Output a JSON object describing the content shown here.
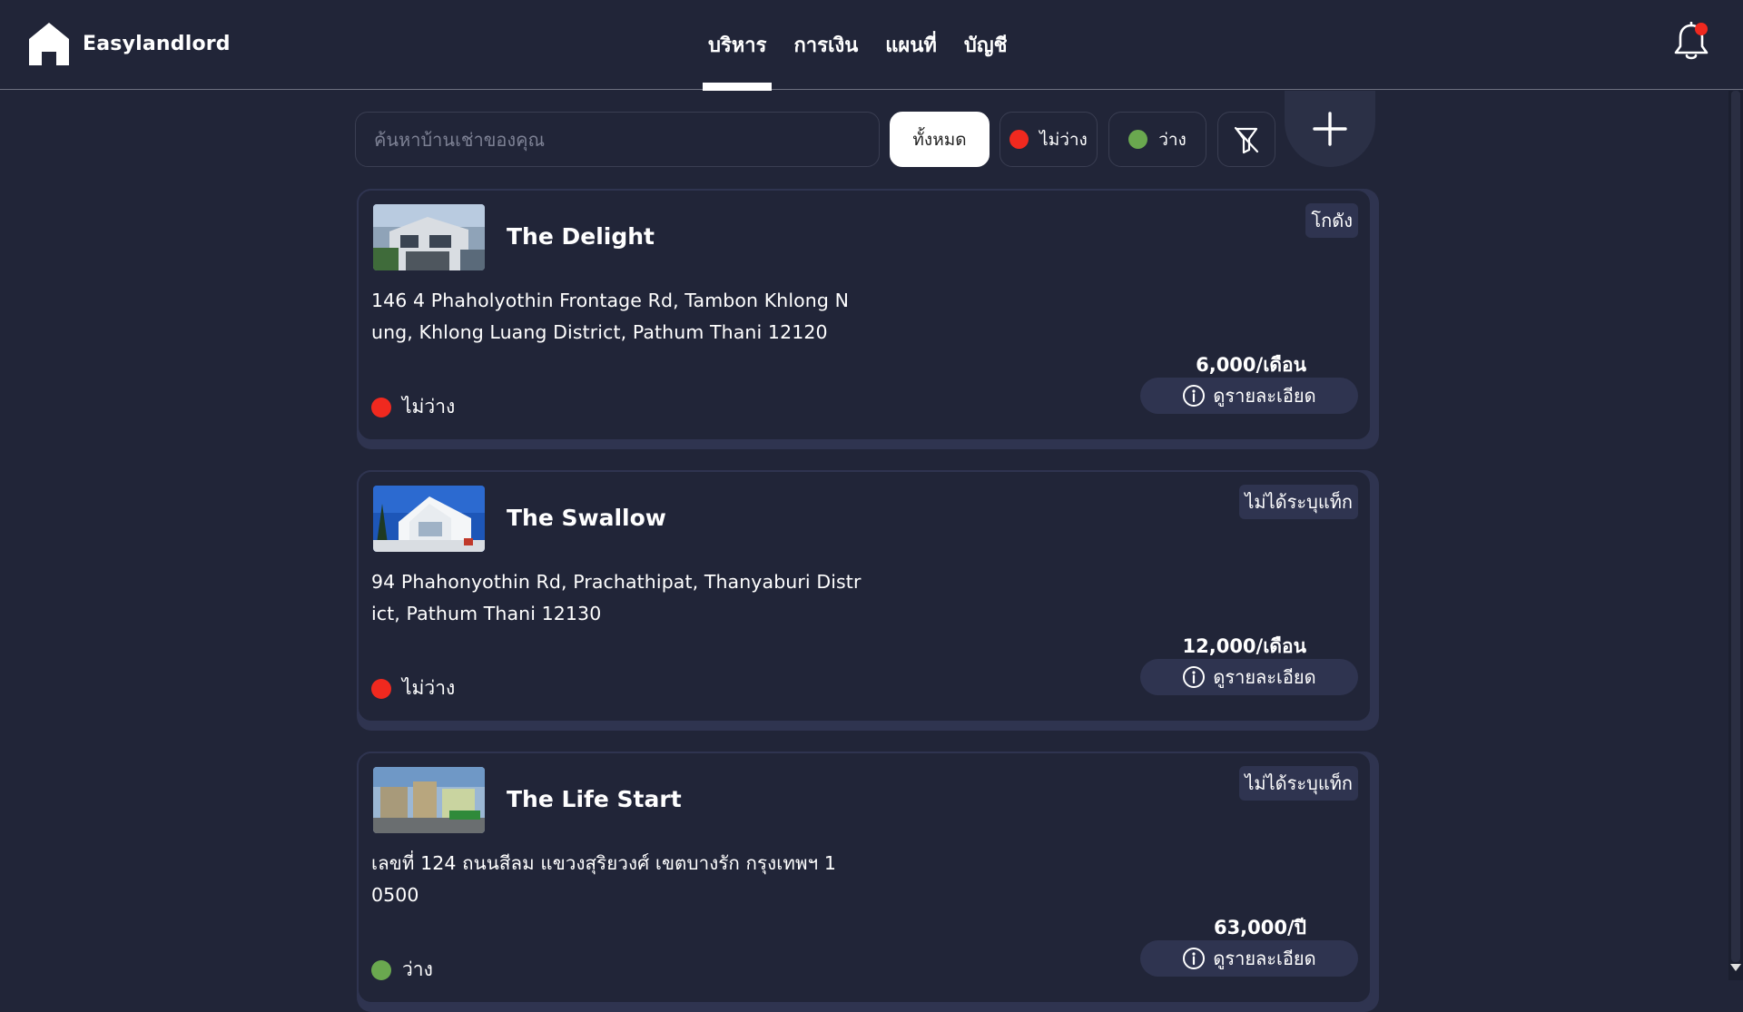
{
  "app": {
    "brand_name": "Easylandlord"
  },
  "nav": {
    "items": [
      {
        "label": "บริหาร",
        "active": true
      },
      {
        "label": "การเงิน",
        "active": false
      },
      {
        "label": "แผนที่",
        "active": false
      },
      {
        "label": "บัญชี",
        "active": false
      }
    ]
  },
  "notifications": {
    "icon": "bell-icon",
    "has_unread": true,
    "dot_color": "#f0291f"
  },
  "filters": {
    "search_placeholder": "ค้นหาบ้านเช่าของคุณ",
    "search_value": "",
    "all_label": "ทั้งหมด",
    "occupied_label": "ไม่ว่าง",
    "vacant_label": "ว่าง",
    "selected": "all",
    "clear_filter_icon": "filter-off-icon",
    "add_icon": "plus-icon"
  },
  "colors": {
    "background": "#212538",
    "card_border": "#2f3450",
    "occupied": "#f0291f",
    "vacant": "#6aa84f"
  },
  "properties": [
    {
      "name": "The Delight",
      "tag": "โกดัง",
      "address": "146 4 Phaholyothin Frontage Rd, Tambon Khlong Nung, Khlong Luang District, Pathum Thani 12120",
      "address_line1": "146 4 Phaholyothin Frontage Rd, Tambon Khlong N",
      "address_line2": "ung, Khlong Luang District, Pathum Thani 12120",
      "status": "ไม่ว่าง",
      "status_type": "occupied",
      "price": "6,000/เดือน",
      "detail_label": "ดูรายละเอียด"
    },
    {
      "name": "The Swallow",
      "tag": "ไม่ได้ระบุแท็ก",
      "address": "94 Phahonyothin Rd, Prachathipat, Thanyaburi District, Pathum Thani 12130",
      "address_line1": "94 Phahonyothin Rd, Prachathipat, Thanyaburi Distr",
      "address_line2": "ict, Pathum Thani 12130",
      "status": "ไม่ว่าง",
      "status_type": "occupied",
      "price": "12,000/เดือน",
      "detail_label": "ดูรายละเอียด"
    },
    {
      "name": "The Life Start",
      "tag": "ไม่ได้ระบุแท็ก",
      "address": "เลขที่ 124 ถนนสีลม แขวงสุริยวงศ์ เขตบางรัก กรุงเทพฯ 10500",
      "address_line1": "เลขที่ 124 ถนนสีลม แขวงสุริยวงศ์ เขตบางรัก กรุงเทพฯ 1",
      "address_line2": "0500",
      "status": "ว่าง",
      "status_type": "vacant",
      "price": "63,000/ปี",
      "detail_label": "ดูรายละเอียด"
    }
  ]
}
